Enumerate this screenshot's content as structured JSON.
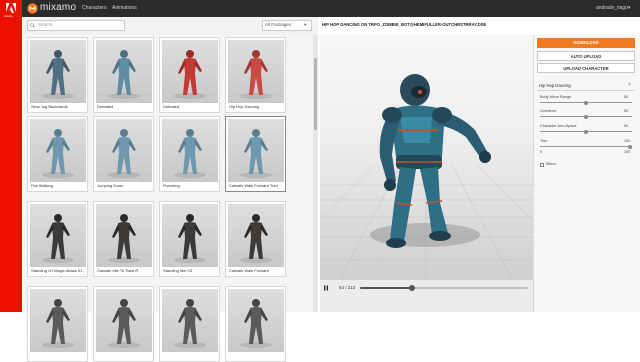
{
  "brand": {
    "adobe": "Adobe",
    "app_name": "mixamo"
  },
  "nav": {
    "characters": "Characters",
    "animations": "Animations"
  },
  "user": {
    "name": "andrade_tiago"
  },
  "browse": {
    "search_placeholder": "Search",
    "sort_label": "All Packages",
    "cards": [
      {
        "label": "Slow Jog Backwards"
      },
      {
        "label": "Defeated"
      },
      {
        "label": "Defeated"
      },
      {
        "label": "Hip Hop Dancing"
      },
      {
        "label": "Flat Walking"
      },
      {
        "label": "Jumping Down"
      },
      {
        "label": "Punching"
      },
      {
        "label": "Catwalk Walk Forward Turn"
      },
      {
        "label": "Standing 1H Magic Attack 01"
      },
      {
        "label": "Catwalk Idle To Twist R"
      },
      {
        "label": "Standing Idle 03"
      },
      {
        "label": "Catwalk Walk Forward"
      },
      {
        "label": ""
      },
      {
        "label": ""
      },
      {
        "label": ""
      },
      {
        "label": ""
      }
    ]
  },
  "viewer": {
    "animation_title": "HIP HOP DANCING ON TRPO_ZOMBIE_BOT@HEMIFULLER-OUTCHRSTRRAY.DSE",
    "frame_counter": "64 / 212",
    "progress": 0.31
  },
  "panel": {
    "download_label": "DOWNLOAD",
    "auto_upload_label": "AUTO UPLOAD",
    "upload_character_label": "UPLOAD CHARACTER",
    "settings_title": "Hip Hop Dancing",
    "sliders": [
      {
        "label": "Body Move Range",
        "value": "50",
        "fraction": 0.5
      },
      {
        "label": "Overdrive",
        "value": "50",
        "fraction": 0.5
      },
      {
        "label": "Character Arm-Space",
        "value": "50",
        "fraction": 0.5
      },
      {
        "label": "Trim",
        "value": "100",
        "fraction": 1.0,
        "min_label": "0"
      }
    ],
    "mirror_label": "Mirror"
  },
  "colors": {
    "adobe_red": "#eb1000",
    "download_orange": "#f27b21",
    "topbar": "#2b2b2b"
  }
}
